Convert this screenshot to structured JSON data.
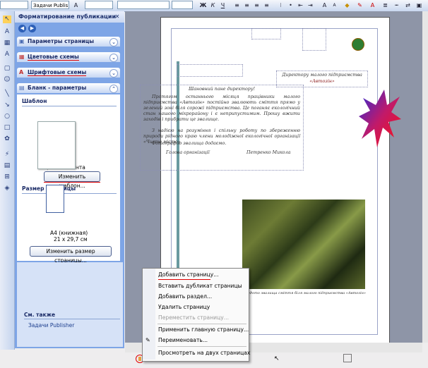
{
  "toolbar": {
    "style_field": "Задачи Publisher",
    "buttons": [
      "Ж",
      "К",
      "Ч"
    ]
  },
  "taskpane": {
    "title": "Форматирование публикации",
    "sections": [
      {
        "label": "Параметры страницы"
      },
      {
        "label": "Цветовые схемы"
      },
      {
        "label": "Шрифтовые схемы"
      },
      {
        "label": "Бланк - параметры"
      }
    ],
    "template_heading": "Шаблон",
    "template_name": "Цветная лента",
    "change_template_button": "Изменить шаблон...",
    "page_size_heading": "Размер страницы",
    "page_size_name": "A4 (книжная)",
    "page_size_dims": "21 x 29,7 см",
    "change_page_size_button": "Изменить размер страницы...",
    "see_also_heading": "См. также",
    "see_also_link": "Задачи Publisher"
  },
  "document": {
    "heading": "Шановний пане директору!",
    "addressee_line1": "Директору малого підприємства",
    "addressee_line2": "«Автозін»",
    "body_paragraph1": "Протягом останнього місяця працівники малого підприємства «Автозін» постійно звалюють сміття прямо у зелений зоні біля сорожі підприємства. Це поганяє екологічний стан нашого мікрорайону і є неприпустимим. Прошу вжити заходів і прибрати це звалище.",
    "body_paragraph2": "З надією на розуміння і спільну роботу по збереженню природи рідного краю члени молодіжної екологічної організації «Чисте місто»",
    "photo_note": "Фотографію звалища додаємо.",
    "sign_left": "Голова організації",
    "sign_right": "Петренко Микола",
    "photo_caption": "Фото звалища сміття біля малого підприємства «Автозін»"
  },
  "context_menu": {
    "items": [
      {
        "label": "Добавить страницу...",
        "enabled": true
      },
      {
        "label": "Вставить дубликат страницы",
        "enabled": true
      },
      {
        "label": "Добавить раздел...",
        "enabled": true
      },
      {
        "label": "Удалить страницу",
        "enabled": true
      },
      {
        "label": "Переместить страницу...",
        "enabled": false
      },
      {
        "label": "Применить главную страницу...",
        "enabled": true
      },
      {
        "label": "Переименовать...",
        "enabled": true
      },
      {
        "label": "Просмотреть на двух страницах",
        "enabled": true
      }
    ]
  },
  "colors": {
    "accent_red": "#e00000",
    "taskpane_blue": "#7ea5e6",
    "canvas_gray": "#8e95a7"
  }
}
